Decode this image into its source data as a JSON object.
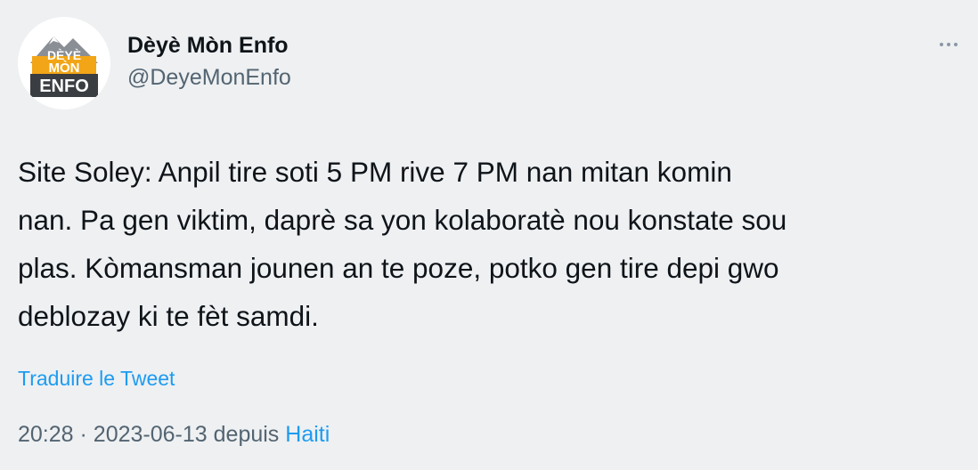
{
  "author": {
    "display_name": "Dèyè Mòn Enfo",
    "handle": "@DeyeMonEnfo",
    "logo_text": {
      "line1": "DÈYÈ",
      "line2": "MÒN",
      "line3": "ENFO"
    },
    "logo_colors": {
      "mountain": "#8a8f95",
      "band": "#f2a516",
      "box": "#3a3d41"
    }
  },
  "tweet": {
    "text": "Site Soley: Anpil tire soti 5 PM rive 7 PM nan mitan komin\nnan. Pa gen viktim, daprè sa yon kolaboratè nou konstate sou\nplas. Kòmansman jounen an te poze, potko gen tire depi gwo\ndeblozay ki te fèt samdi.",
    "translate_label": "Traduire le Tweet"
  },
  "meta": {
    "time": "20:28",
    "separator": "·",
    "date": "2023-06-13",
    "source_prefix": "depuis",
    "source": "Haiti"
  },
  "icons": {
    "more": "more-horizontal-icon"
  },
  "colors": {
    "background": "#eef0f2",
    "text": "#0f1419",
    "secondary": "#536471",
    "accent": "#1d9bf0"
  }
}
